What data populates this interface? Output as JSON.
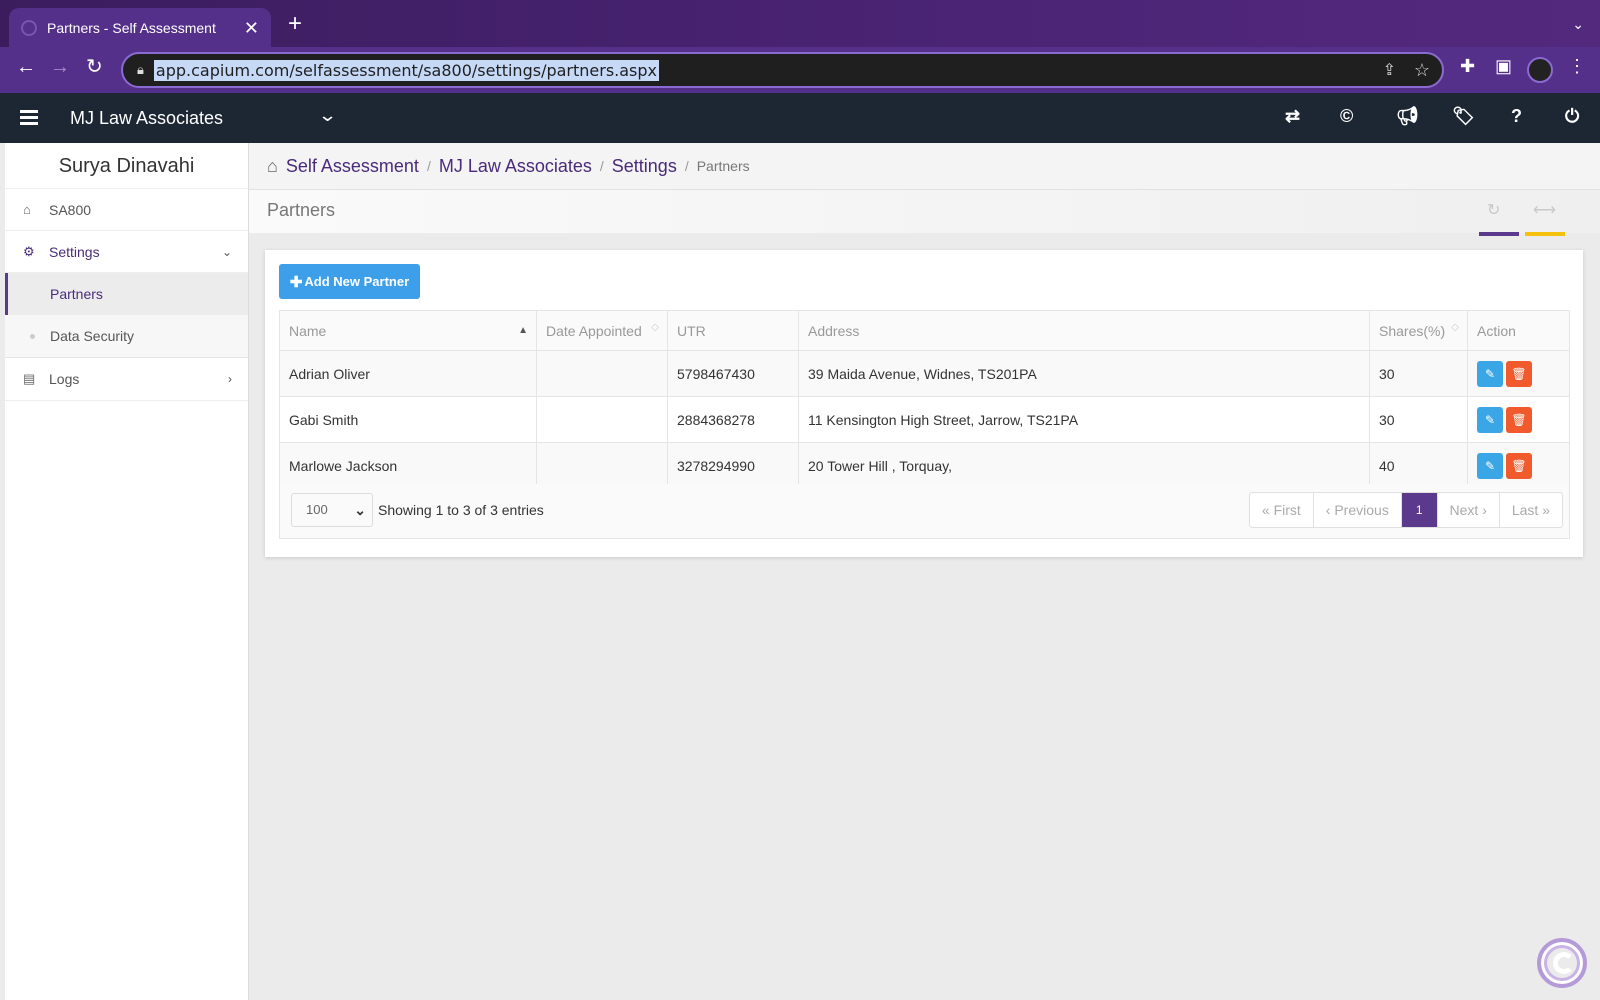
{
  "browser": {
    "tab_title": "Partners - Self Assessment",
    "url": "app.capium.com/selfassessment/sa800/settings/partners.aspx"
  },
  "header": {
    "practice_name": "MJ Law Associates",
    "icons": [
      "switch-icon",
      "capium-icon",
      "announcement-icon",
      "ticket-icon",
      "help-icon",
      "power-icon"
    ]
  },
  "sidebar": {
    "user_name": "Surya Dinavahi",
    "items": [
      {
        "label": "SA800",
        "icon": "home-icon"
      },
      {
        "label": "Settings",
        "icon": "gear-icon"
      },
      {
        "label": "Partners"
      },
      {
        "label": "Data Security"
      },
      {
        "label": "Logs",
        "icon": "file-icon"
      }
    ]
  },
  "breadcrumb": {
    "items": [
      "Self Assessment",
      "MJ Law Associates",
      "Settings",
      "Partners"
    ]
  },
  "page": {
    "title": "Partners",
    "add_button": "Add New Partner"
  },
  "table": {
    "headers": [
      "Name",
      "Date Appointed",
      "UTR",
      "Address",
      "Shares(%)",
      "Action"
    ],
    "rows": [
      {
        "name": "Adrian Oliver",
        "date": "",
        "utr": "5798467430",
        "address": "39 Maida Avenue, Widnes, TS201PA",
        "shares": "30"
      },
      {
        "name": "Gabi Smith",
        "date": "",
        "utr": "2884368278",
        "address": "11 Kensington High Street, Jarrow, TS21PA",
        "shares": "30"
      },
      {
        "name": "Marlowe Jackson",
        "date": "",
        "utr": "3278294990",
        "address": "20 Tower Hill , Torquay,",
        "shares": "40"
      }
    ]
  },
  "pagination": {
    "page_size": "100",
    "info": "Showing 1 to 3 of 3 entries",
    "first": "« First",
    "previous": "‹ Previous",
    "current": "1",
    "next": "Next ›",
    "last": "Last »"
  },
  "colors": {
    "accent": "#5b3a8e",
    "add_button": "#3d9fea",
    "edit": "#3aa6e6",
    "delete": "#f05a2c",
    "header_bg": "#1c2733"
  }
}
